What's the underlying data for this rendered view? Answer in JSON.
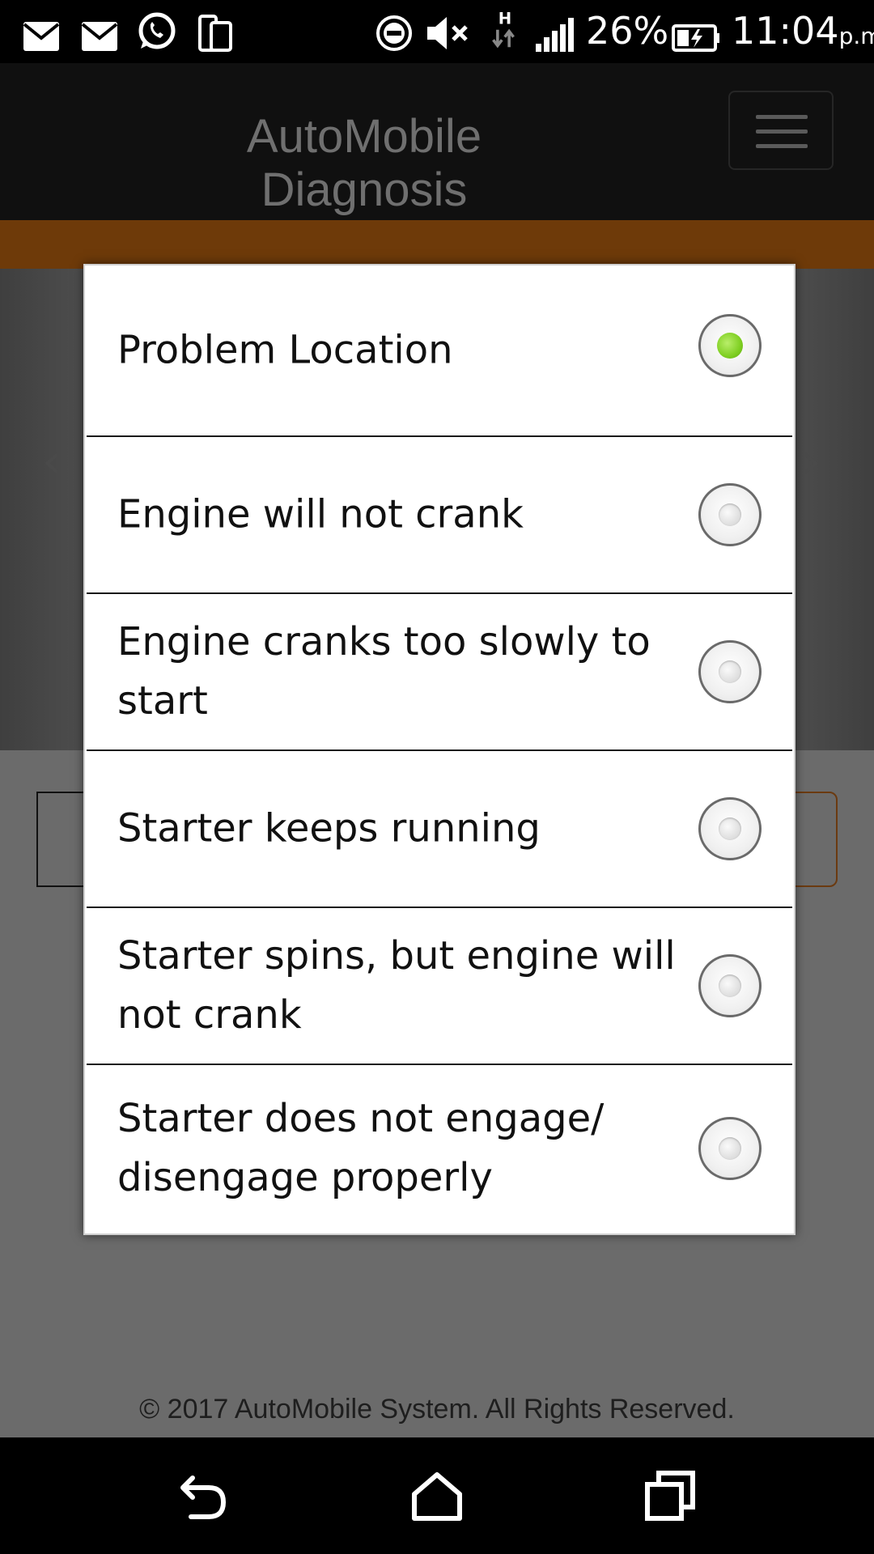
{
  "status_bar": {
    "battery": "26%",
    "time": "11:04",
    "ampm": "p.m.",
    "icons": [
      "gmail-icon",
      "mail-icon",
      "whatsapp-icon",
      "phone-tablet-icon",
      "do-not-disturb-icon",
      "mute-icon",
      "hspa-data-icon",
      "signal-icon",
      "battery-charging-icon"
    ]
  },
  "header": {
    "title": "AutoMobile\nDiagnosis",
    "menu_icon": "hamburger-menu-icon"
  },
  "dialog": {
    "options": [
      {
        "label": "Problem Location",
        "selected": true
      },
      {
        "label": "Engine will not crank",
        "selected": false
      },
      {
        "label": "Engine cranks too slowly to start",
        "selected": false
      },
      {
        "label": "Starter keeps running",
        "selected": false
      },
      {
        "label": "Starter spins, but engine will not crank",
        "selected": false
      },
      {
        "label": "Starter does not engage/ disengage properly",
        "selected": false
      }
    ]
  },
  "background": {
    "carousel_prev_icon": "chevron-left-icon",
    "carousel_next_icon": "chevron-right-icon"
  },
  "footer": {
    "copyright": "© 2017 AutoMobile System. All Rights Reserved."
  },
  "nav_bar": {
    "icons": [
      "back-icon",
      "home-icon",
      "recents-icon"
    ]
  },
  "colors": {
    "accent_orange": "#6e3a09",
    "radio_selected": "#7fcf22",
    "header_bg": "#101010"
  }
}
